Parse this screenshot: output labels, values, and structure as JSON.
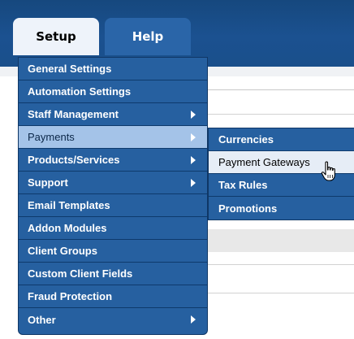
{
  "nav": {
    "tabs": [
      {
        "label": "Setup",
        "active": true
      },
      {
        "label": "Help",
        "active": false
      }
    ]
  },
  "menu": {
    "items": [
      {
        "label": "General Settings"
      },
      {
        "label": "Automation Settings"
      },
      {
        "label": "Staff Management"
      },
      {
        "label": "Payments"
      },
      {
        "label": "Products/Services"
      },
      {
        "label": "Support"
      },
      {
        "label": "Email Templates"
      },
      {
        "label": "Addon Modules"
      },
      {
        "label": "Client Groups"
      },
      {
        "label": "Custom Client Fields"
      },
      {
        "label": "Fraud Protection"
      },
      {
        "label": "Other"
      }
    ]
  },
  "submenu": {
    "items": [
      {
        "label": "Currencies"
      },
      {
        "label": "Payment Gateways"
      },
      {
        "label": "Tax Rules"
      },
      {
        "label": "Promotions"
      }
    ]
  },
  "colors": {
    "menu_bg": "#2660a0",
    "active_item_bg": "#a4c3e8",
    "hover_item_bg": "#e6edf6"
  }
}
